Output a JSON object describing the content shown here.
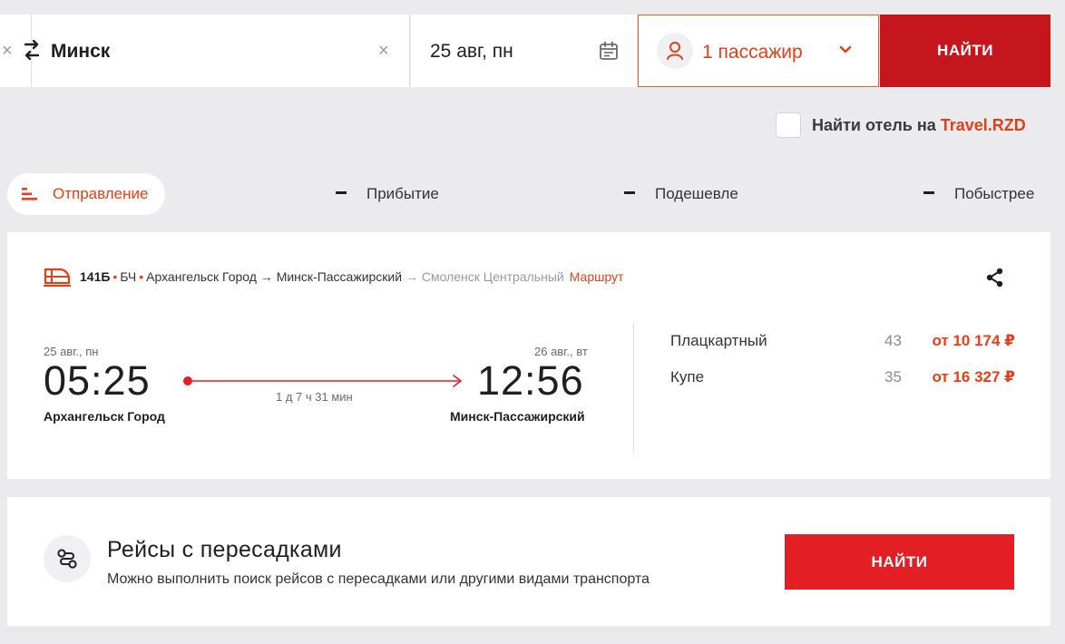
{
  "search": {
    "destination": "Минск",
    "date": "25 авг, пн",
    "passengers": "1 пассажир",
    "find_label": "НАЙТИ"
  },
  "hotel": {
    "label_prefix": "Найти отель на ",
    "brand": "Travel.RZD"
  },
  "sort": {
    "departure": "Отправление",
    "arrival": "Прибытие",
    "cheaper": "Подешевле",
    "faster": "Побыстрее"
  },
  "train": {
    "number": "141Б",
    "carrier": "БЧ",
    "from": "Архангельск Город",
    "to": "Минск-Пассажирский",
    "final_to": "Смоленск Центральный",
    "route_link": "Маршрут",
    "departure": {
      "date": "25 авг., пн",
      "time": "05:25",
      "station": "Архангельск Город"
    },
    "arrival": {
      "date": "26 авг., вт",
      "time": "12:56",
      "station": "Минск-Пассажирский"
    },
    "duration": "1 д 7 ч 31 мин",
    "fares": [
      {
        "class": "Плацкартный",
        "seats": "43",
        "price": "от 10 174 ₽"
      },
      {
        "class": "Купе",
        "seats": "35",
        "price": "от 16 327 ₽"
      }
    ]
  },
  "transfers": {
    "title": "Рейсы с пересадками",
    "subtitle": "Можно выполнить поиск рейсов с пересадками или другими видами транспорта",
    "find_label": "НАЙТИ"
  },
  "colors": {
    "accent": "#e2401b",
    "button_dark": "#c4161c",
    "button": "#e31e24",
    "background": "#ebebee"
  }
}
